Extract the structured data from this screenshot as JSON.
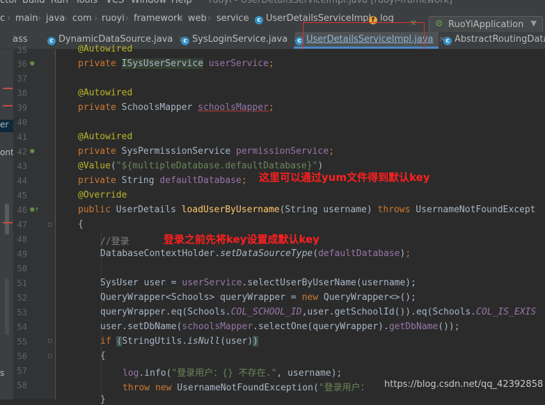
{
  "menubar": [
    "ctor",
    "Build",
    "Run",
    "Tools",
    "VCS",
    "Window",
    "Help",
    "ruoyi - UserDetailsServiceImpl.java [ruoyi-framework]"
  ],
  "breadcrumb": [
    "c",
    "main",
    "java",
    "com",
    "ruoyi",
    "framework",
    "web",
    "service",
    "UserDetailsServiceImpl",
    "log"
  ],
  "run_config": "RuoYiApplication",
  "tabs": [
    {
      "label": "ass"
    },
    {
      "label": "DynamicDataSource.java"
    },
    {
      "label": "SysLoginService.java"
    },
    {
      "label": "UserDetailsServiceImpl.java",
      "active": true
    },
    {
      "label": "AbstractRoutingDataS"
    }
  ],
  "side": {
    "sel_label": "er",
    "ont_label": "ont",
    "s_label": "s"
  },
  "line_numbers": [
    "35",
    "36",
    "37",
    "38",
    "39",
    "40",
    "41",
    "42",
    "43",
    "44",
    "45",
    "46",
    "47",
    "48",
    "49",
    "50",
    "51",
    "52",
    "53",
    "54",
    "55",
    "56",
    "57",
    "58"
  ],
  "code": {
    "l35": "@Autowired",
    "l36_kw": "private",
    "l36_type": "ISysUserService",
    "l36_var": "userService",
    "l38": "@Autowired",
    "l39_kw": "private",
    "l39_type": "SchoolsMapper",
    "l39_var": "schoolsMapper",
    "l41": "@Autowired",
    "l42_kw": "private",
    "l42_type": "SysPermissionService",
    "l42_var": "permissionService",
    "l43_an": "@Value",
    "l43_str": "\"${multipleDatabase.defaultDatabase}\"",
    "l44_kw": "private",
    "l44_type": "String",
    "l44_var": "defaultDatabase",
    "l45": "@Override",
    "l46_kw1": "public",
    "l46_type": "UserDetails",
    "l46_mt": "loadUserByUsername",
    "l46_params": "(String username)",
    "l46_kw2": "throws",
    "l46_exc": "UsernameNotFoundExcept",
    "l47": "{",
    "l48": "//登录",
    "l49_a": "DatabaseContextHolder.",
    "l49_m": "setDataSourceType",
    "l49_v": "defaultDatabase",
    "l51_a": "SysUser user = ",
    "l51_f": "userService",
    "l51_b": ".selectUserByUserName(username);",
    "l52_a": "QueryWrapper<Schools> queryWrapper = ",
    "l52_kw": "new",
    "l52_b": " QueryWrapper<>();",
    "l53_a": "queryWrapper.eq(Schools.",
    "l53_c1": "COL_SCHOOL_ID",
    "l53_b": ",user.getSchoolId()).eq(Schools.",
    "l53_c2": "COL_IS_EXIS",
    "l54_a": "user.setDbName(",
    "l54_f": "schoolsMapper",
    "l54_b": ".selectOne(queryWrapper).",
    "l54_m": "getDbName",
    "l54_c": "());",
    "l55_kw": "if",
    "l55_a": "StringUtils.",
    "l55_m": "isNull",
    "l55_b": "(user)",
    "l56": "{",
    "l57_f": "log",
    "l57_a": ".info(",
    "l57_s": "\"登录用户：{} 不存在.\"",
    "l57_b": ", username);",
    "l58_kw1": "throw",
    "l58_kw2": "new",
    "l58_a": " UsernameNotFoundException(",
    "l58_s": "\"登录用户：",
    "l59": "}"
  },
  "annotations": {
    "note1": "这里可以通过yum文件得到默认key",
    "note2": "登录之前先将key设置成默认key"
  },
  "watermark": "https://blog.csdn.net/qq_42392858",
  "colors": {
    "highlight": "#e03030",
    "keyword": "#cc7832",
    "annotation": "#bbb529",
    "field": "#9876aa"
  }
}
